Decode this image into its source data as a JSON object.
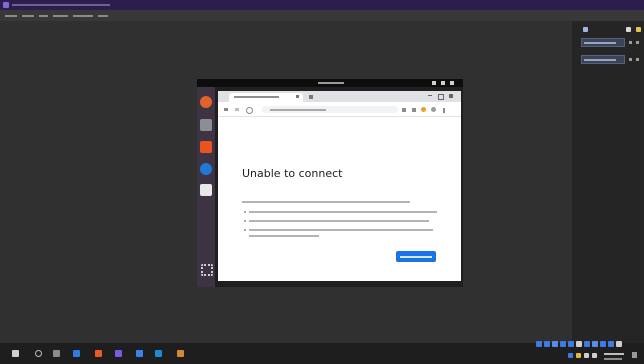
{
  "window": {
    "title": "",
    "accent": "#2c1d4c"
  },
  "menubar": {
    "items": [
      "",
      "",
      "",
      "",
      "",
      ""
    ]
  },
  "right_panel": {
    "fields": [
      "",
      ""
    ]
  },
  "vm": {
    "dock": {
      "icons": [
        "firefox-icon",
        "files-icon",
        "software-icon",
        "thunderbird-icon",
        "writer-icon",
        "apps-grid-icon"
      ]
    },
    "browser": {
      "tab_title": "",
      "url": "",
      "error": {
        "title": "Unable to connect",
        "message": "",
        "bullets": [
          "",
          "",
          ""
        ],
        "button_label": ""
      },
      "button_color": "#1a73e8"
    }
  },
  "taskbar": {
    "icons": [
      "start-icon",
      "search-icon",
      "taskview-icon",
      "explorer-icon",
      "app-icon",
      "app-icon",
      "app-icon",
      "app-icon",
      "app-icon"
    ]
  }
}
